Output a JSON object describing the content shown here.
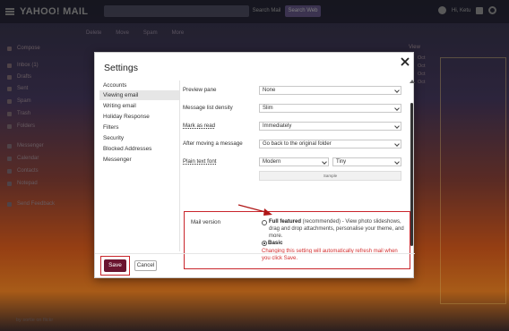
{
  "app": {
    "logo": "YAHOO! MAIL",
    "search_mail_label": "Search Mail",
    "search_web_label": "Search Web",
    "user_name": "Hi, Ketu",
    "sidebar_items": [
      "Compose",
      "Inbox (1)",
      "Drafts",
      "Sent",
      "Spam",
      "Trash",
      "Folders",
      "Messenger",
      "Calendar",
      "Contacts",
      "Notepad",
      "Send Feedback"
    ],
    "toolbar_items": [
      "Delete",
      "Move",
      "Spam",
      "More"
    ],
    "view_menu": "View",
    "dates": [
      "Oct",
      "Oct",
      "Oct",
      "Oct"
    ],
    "photo_credit": "by sortie on flickr"
  },
  "dialog": {
    "title": "Settings",
    "nav": [
      "Accounts",
      "Viewing email",
      "Writing email",
      "Holiday Response",
      "Filters",
      "Security",
      "Blocked Addresses",
      "Messenger"
    ],
    "active_nav": "Viewing email",
    "rows": [
      {
        "label": "Preview pane",
        "value": "None"
      },
      {
        "label": "Message list density",
        "value": "Slim"
      },
      {
        "label": "Mark as read",
        "value": "Immediately"
      },
      {
        "label": "After moving a message",
        "value": "Go back to the original folder"
      }
    ],
    "plain_text_font": {
      "label": "Plain text font",
      "font": "Modern",
      "size": "Tiny",
      "sample": "Sample"
    },
    "mail_version": {
      "label": "Mail version",
      "full_title": "Full featured",
      "full_desc_suffix": " (recommended) - View photo slideshows, drag and drop attachments, personalise your theme, and more.",
      "basic_title": "Basic",
      "selected": "Basic",
      "warning": "Changing this setting will automatically refresh mail when you click Save."
    },
    "save_label": "Save",
    "cancel_label": "Cancel",
    "highlight_color": "#c9252b",
    "save_color": "#6b1530"
  }
}
